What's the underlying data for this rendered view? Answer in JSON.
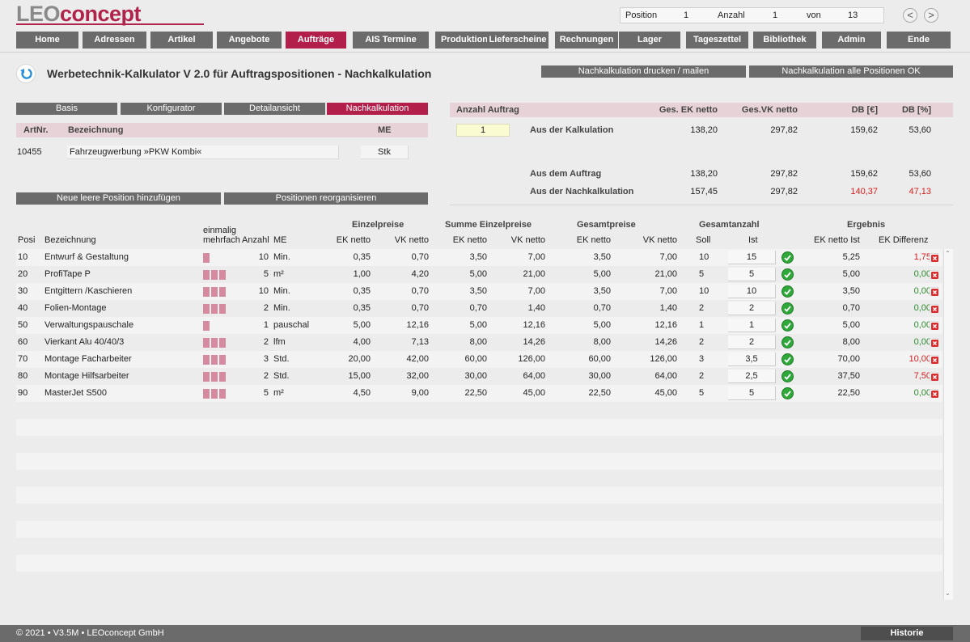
{
  "app": {
    "logo_part1": "LEO",
    "logo_part2": "concept",
    "position_label": "Position",
    "position_value": "1",
    "anzahl_label": "Anzahl",
    "anzahl_value": "1",
    "von_label": "von",
    "von_value": "13",
    "prev": "<",
    "next": ">"
  },
  "nav": [
    "Home",
    "Adressen",
    "Artikel",
    "Angebote",
    "Aufträge",
    "AIS Termine",
    "Produktion",
    "Lieferscheine",
    "Rechnungen",
    "Lager",
    "Tageszettel",
    "Bibliothek",
    "Admin",
    "Ende"
  ],
  "nav_active": "Aufträge",
  "page": {
    "title": "Werbetechnik-Kalkulator V 2.0 für Auftragspositionen - Nachkalkulation",
    "btn_print": "Nachkalkulation drucken / mailen",
    "btn_all_ok": "Nachkalkulation alle Positionen OK"
  },
  "subtabs": [
    "Basis",
    "Konfigurator",
    "Detailansicht",
    "Nachkalkulation"
  ],
  "subtab_active": "Nachkalkulation",
  "article": {
    "h_artnr": "ArtNr.",
    "h_bez": "Bezeichnung",
    "h_me": "ME",
    "artnr": "10455",
    "bez": "Fahrzeugwerbung »PKW Kombi«",
    "me": "Stk",
    "btn_new": "Neue leere Position hinzufügen",
    "btn_reorg": "Positionen reorganisieren"
  },
  "summary": {
    "h_anzahl": "Anzahl Auftrag",
    "h_ek": "Ges. EK netto",
    "h_vk": "Ges.VK netto",
    "h_db": "DB [€]",
    "h_dbp": "DB [%]",
    "anzahl": "1",
    "rows": [
      {
        "label": "Aus der Kalkulation",
        "ek": "138,20",
        "vk": "297,82",
        "db": "159,62",
        "dbp": "53,60"
      },
      {
        "label": "Aus dem Auftrag",
        "ek": "138,20",
        "vk": "297,82",
        "db": "159,62",
        "dbp": "53,60"
      },
      {
        "label": "Aus der Nachkalkulation",
        "ek": "157,45",
        "vk": "297,82",
        "db": "140,37",
        "dbp": "47,13"
      }
    ]
  },
  "table": {
    "groups": {
      "einzel": "Einzelpreise",
      "summe": "Summe Einzelpreise",
      "gesamt": "Gesamtpreise",
      "gesamtanzahl": "Gesamtanzahl",
      "ergebnis": "Ergebnis"
    },
    "einmalig": "einmalig",
    "mehrfach": "mehrfach",
    "cols": {
      "posi": "Posi",
      "bez": "Bezeichnung",
      "anzahl": "Anzahl",
      "me": "ME",
      "ek": "EK netto",
      "vk": "VK netto",
      "soll": "Soll",
      "ist": "Ist",
      "ekist": "EK netto Ist",
      "ekdiff": "EK Differenz"
    },
    "rows": [
      {
        "posi": "10",
        "bez": "Entwurf & Gestaltung",
        "bars": 1,
        "anzahl": "10",
        "me": "Min.",
        "ek": "0,35",
        "vk": "0,70",
        "sek": "3,50",
        "svk": "7,00",
        "gek": "3,50",
        "gvk": "7,00",
        "soll": "10",
        "ist": "15",
        "ekist": "5,25",
        "diff": "1,75",
        "diff_red": true
      },
      {
        "posi": "20",
        "bez": "ProfiTape P",
        "bars": 3,
        "anzahl": "5",
        "me": "m²",
        "ek": "1,00",
        "vk": "4,20",
        "sek": "5,00",
        "svk": "21,00",
        "gek": "5,00",
        "gvk": "21,00",
        "soll": "5",
        "ist": "5",
        "ekist": "5,00",
        "diff": "0,00",
        "diff_red": false
      },
      {
        "posi": "30",
        "bez": "Entgittern /Kaschieren",
        "bars": 3,
        "anzahl": "10",
        "me": "Min.",
        "ek": "0,35",
        "vk": "0,70",
        "sek": "3,50",
        "svk": "7,00",
        "gek": "3,50",
        "gvk": "7,00",
        "soll": "10",
        "ist": "10",
        "ekist": "3,50",
        "diff": "0,00",
        "diff_red": false
      },
      {
        "posi": "40",
        "bez": "Folien-Montage",
        "bars": 3,
        "anzahl": "2",
        "me": "Min.",
        "ek": "0,35",
        "vk": "0,70",
        "sek": "0,70",
        "svk": "1,40",
        "gek": "0,70",
        "gvk": "1,40",
        "soll": "2",
        "ist": "2",
        "ekist": "0,70",
        "diff": "0,00",
        "diff_red": false
      },
      {
        "posi": "50",
        "bez": "Verwaltungspauschale",
        "bars": 1,
        "anzahl": "1",
        "me": "pauschal",
        "ek": "5,00",
        "vk": "12,16",
        "sek": "5,00",
        "svk": "12,16",
        "gek": "5,00",
        "gvk": "12,16",
        "soll": "1",
        "ist": "1",
        "ekist": "5,00",
        "diff": "0,00",
        "diff_red": false
      },
      {
        "posi": "60",
        "bez": "Vierkant Alu 40/40/3",
        "bars": 3,
        "anzahl": "2",
        "me": "lfm",
        "ek": "4,00",
        "vk": "7,13",
        "sek": "8,00",
        "svk": "14,26",
        "gek": "8,00",
        "gvk": "14,26",
        "soll": "2",
        "ist": "2",
        "ekist": "8,00",
        "diff": "0,00",
        "diff_red": false
      },
      {
        "posi": "70",
        "bez": "Montage Facharbeiter",
        "bars": 3,
        "anzahl": "3",
        "me": "Std.",
        "ek": "20,00",
        "vk": "42,00",
        "sek": "60,00",
        "svk": "126,00",
        "gek": "60,00",
        "gvk": "126,00",
        "soll": "3",
        "ist": "3,5",
        "ekist": "70,00",
        "diff": "10,00",
        "diff_red": true
      },
      {
        "posi": "80",
        "bez": "Montage Hilfsarbeiter",
        "bars": 3,
        "anzahl": "2",
        "me": "Std.",
        "ek": "15,00",
        "vk": "32,00",
        "sek": "30,00",
        "svk": "64,00",
        "gek": "30,00",
        "gvk": "64,00",
        "soll": "2",
        "ist": "2,5",
        "ekist": "37,50",
        "diff": "7,50",
        "diff_red": true
      },
      {
        "posi": "90",
        "bez": "MasterJet S500",
        "bars": 3,
        "anzahl": "5",
        "me": "m²",
        "ek": "4,50",
        "vk": "9,00",
        "sek": "22,50",
        "svk": "45,00",
        "gek": "22,50",
        "gvk": "45,00",
        "soll": "5",
        "ist": "5",
        "ekist": "22,50",
        "diff": "0,00",
        "diff_red": false
      }
    ]
  },
  "footer": {
    "copy": "© 2021 • V3.5M • LEOconcept GmbH",
    "historie": "Historie"
  }
}
